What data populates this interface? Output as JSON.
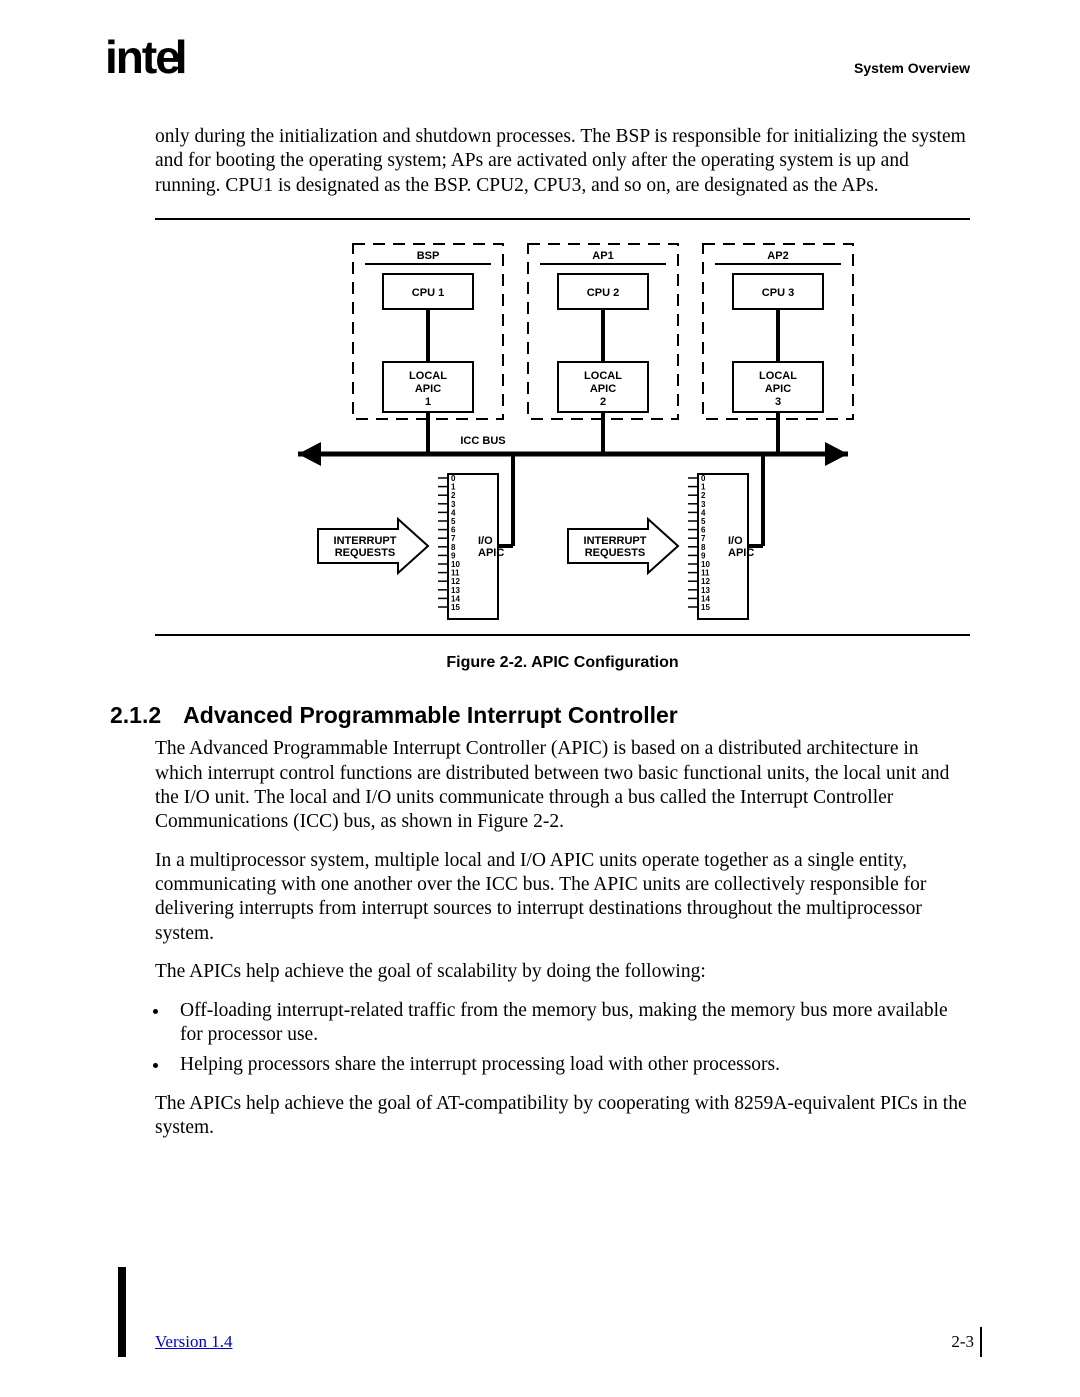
{
  "logo_text": "intel",
  "header_right": "System Overview",
  "intro_paragraph": "only during the initialization and shutdown processes.  The BSP is responsible for initializing the system and for booting the operating system; APs are activated only after the operating system is up and running.  CPU1 is designated as the BSP.  CPU2, CPU3, and so on, are designated as the APs.",
  "figure": {
    "caption": "Figure 2-2.  APIC Configuration",
    "proc1_role": "BSP",
    "proc2_role": "AP1",
    "proc3_role": "AP2",
    "cpu1": "CPU 1",
    "cpu2": "CPU 2",
    "cpu3": "CPU 3",
    "lapic1a": "LOCAL",
    "lapic1b": "APIC",
    "lapic1c": "1",
    "lapic2a": "LOCAL",
    "lapic2b": "APIC",
    "lapic2c": "2",
    "lapic3a": "LOCAL",
    "lapic3b": "APIC",
    "lapic3c": "3",
    "bus_label": "ICC BUS",
    "int_req1a": "INTERRUPT",
    "int_req1b": "REQUESTS",
    "int_req2a": "INTERRUPT",
    "int_req2b": "REQUESTS",
    "io_apic1a": "I/O",
    "io_apic1b": "APIC",
    "io_apic2a": "I/O",
    "io_apic2b": "APIC",
    "pin_labels": [
      "0",
      "1",
      "2",
      "3",
      "4",
      "5",
      "6",
      "7",
      "8",
      "9",
      "10",
      "11",
      "12",
      "13",
      "14",
      "15"
    ]
  },
  "section": {
    "number": "2.1.2",
    "title": "Advanced Programmable Interrupt Controller",
    "p1": "The Advanced Programmable Interrupt Controller (APIC) is based on a distributed architecture in which interrupt control functions are distributed between two basic functional units, the local unit and the I/O unit.  The local and I/O units communicate through a bus called the Interrupt Controller Communications (ICC) bus, as shown in  Figure 2-2.",
    "p2": "In a multiprocessor system, multiple local and I/O APIC units operate together as a single entity, communicating with one another over the ICC bus.  The APIC units are collectively responsible for delivering interrupts from interrupt sources to interrupt destinations throughout the multiprocessor system.",
    "p3": "The APICs help achieve the goal of scalability by doing the following:",
    "bullet1": "Off-loading interrupt-related traffic from the memory bus, making the memory bus more available for processor use.",
    "bullet2": "Helping processors share the interrupt processing load with other processors.",
    "p4": "The APICs help achieve the goal of AT-compatibility by cooperating with 8259A-equivalent PICs in the system."
  },
  "footer": {
    "left": "Version 1.4",
    "right": "2-3"
  }
}
